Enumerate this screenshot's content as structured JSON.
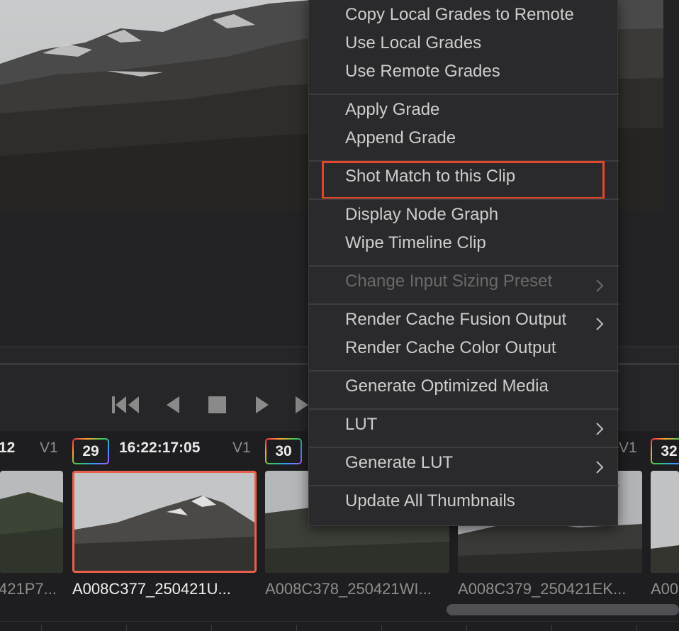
{
  "context_menu": {
    "items": [
      {
        "label": "Copy Local Grades to Remote"
      },
      {
        "label": "Use Local Grades"
      },
      {
        "label": "Use Remote Grades"
      },
      {
        "label": "Apply Grade"
      },
      {
        "label": "Append Grade"
      },
      {
        "label": "Shot Match to this Clip",
        "highlighted": true
      },
      {
        "label": "Display Node Graph"
      },
      {
        "label": "Wipe Timeline Clip"
      },
      {
        "label": "Change Input Sizing Preset",
        "disabled": true,
        "submenu": true
      },
      {
        "label": "Render Cache Fusion Output",
        "submenu": true
      },
      {
        "label": "Render Cache Color Output"
      },
      {
        "label": "Generate Optimized Media"
      },
      {
        "label": "LUT",
        "submenu": true
      },
      {
        "label": "Generate LUT",
        "submenu": true
      },
      {
        "label": "Update All Thumbnails"
      }
    ],
    "highlight_color": "#e2472c"
  },
  "transport": {
    "icons": [
      "jump-to-start-icon",
      "play-reverse-icon",
      "stop-icon",
      "play-icon",
      "play-forward-icon"
    ]
  },
  "clips": [
    {
      "number": "12",
      "track": "V1",
      "name": "421P7..."
    },
    {
      "number": "29",
      "timecode": "16:22:17:05",
      "track": "V1",
      "name": "A008C377_250421U...",
      "selected": true
    },
    {
      "number": "30",
      "name": "A008C378_250421WI..."
    },
    {
      "track": "V1",
      "name": "A008C379_250421EK..."
    },
    {
      "number": "32",
      "name": "A00"
    }
  ],
  "colors": {
    "selection": "#e9604a",
    "background": "#1c1c1e"
  }
}
